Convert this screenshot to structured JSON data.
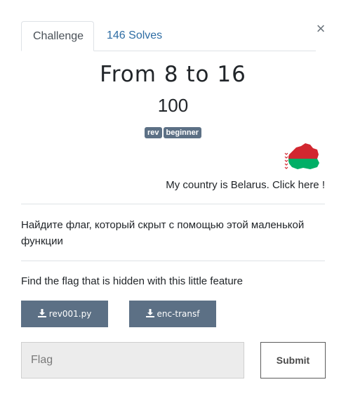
{
  "tabs": [
    {
      "label": "Challenge",
      "active": true
    },
    {
      "label": "146 Solves",
      "active": false
    }
  ],
  "close_icon": "×",
  "challenge": {
    "name": "From 8 to 16",
    "points": "100",
    "tags": [
      "rev",
      "beginner"
    ],
    "country_link": "My country is Belarus. Click here !",
    "description_ru": "Найдите флаг, который скрыт с помощью этой маленькой функции",
    "description_en": "Find the flag that is hidden with this little feature"
  },
  "files": [
    {
      "label": "rev001.py",
      "icon": "download-icon"
    },
    {
      "label": "enc-transf",
      "icon": "download-icon"
    }
  ],
  "submission": {
    "placeholder": "Flag",
    "submit_label": "Submit"
  },
  "colors": {
    "badge": "#5c7085",
    "button": "#5c7085",
    "link": "#2e6da4",
    "flag_red": "#d22730",
    "flag_green": "#00af66"
  }
}
